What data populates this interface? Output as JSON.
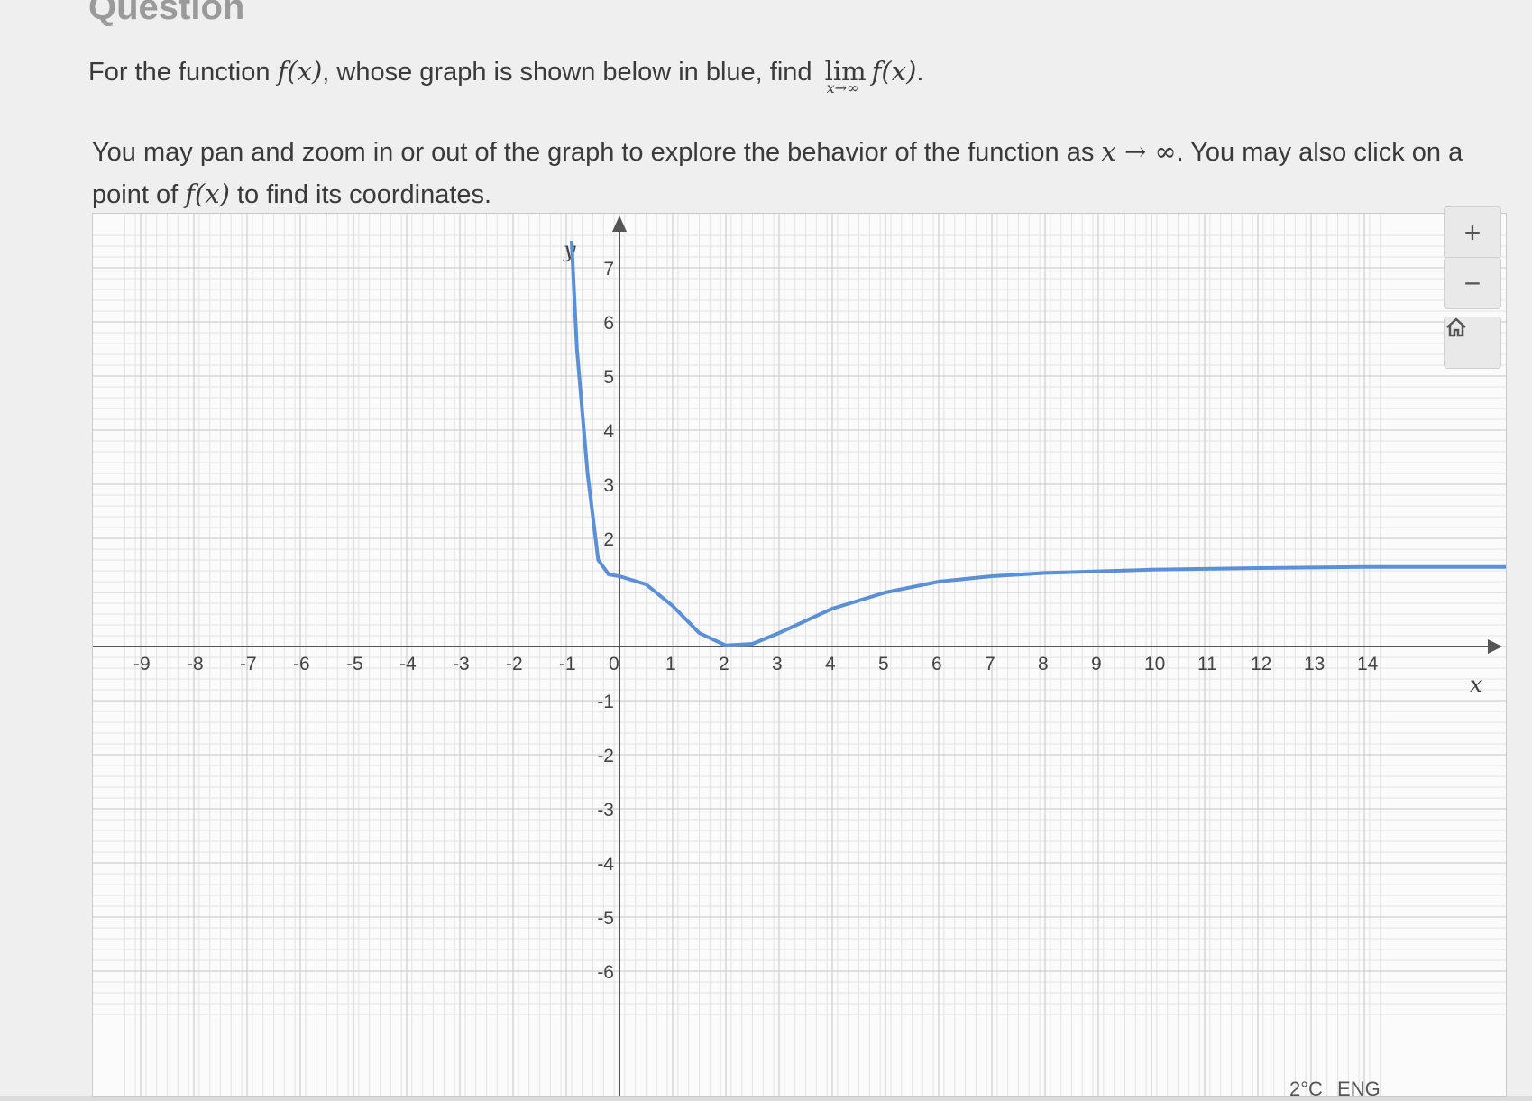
{
  "question": {
    "title": "Question",
    "line1_pre": "For the function ",
    "fx": "f(x)",
    "line1_mid": ", whose graph is shown below in blue, find ",
    "lim_word": "lim",
    "lim_sub": "x→∞",
    "line1_post": ".",
    "line2_a": "You may pan and zoom in or out of the graph to explore the behavior of the function as ",
    "x_to_inf": "x → ∞",
    "line2_b": ". You may also click on a point of ",
    "line2_c": " to find its coordinates."
  },
  "graph_controls": {
    "zoom_in": "+",
    "zoom_out": "−",
    "home_icon": "home-icon"
  },
  "axes": {
    "x_label": "x",
    "y_label": "y",
    "x_ticks": [
      "-9",
      "-8",
      "-7",
      "-6",
      "-5",
      "-4",
      "-3",
      "-2",
      "-1",
      "0",
      "1",
      "2",
      "3",
      "4",
      "5",
      "6",
      "7",
      "8",
      "9",
      "10",
      "11",
      "12",
      "13",
      "14"
    ],
    "y_ticks": [
      "7",
      "6",
      "5",
      "4",
      "3",
      "2",
      "-1",
      "-2",
      "-3",
      "-4",
      "-5",
      "-6"
    ]
  },
  "chart_data": {
    "type": "line",
    "series": [
      {
        "x": [
          -0.9,
          -0.8,
          -0.6,
          -0.4,
          -0.2,
          0,
          0.5,
          1,
          1.5,
          2,
          2.5,
          3,
          4,
          5,
          6,
          7,
          8,
          10,
          12,
          14
        ],
        "y": [
          7.5,
          5.5,
          3.2,
          1.6,
          1.33,
          1.3,
          1.15,
          0.75,
          0.25,
          0.02,
          0.05,
          0.25,
          0.7,
          1.0,
          1.2,
          1.3,
          1.36,
          1.42,
          1.45,
          1.47
        ],
        "color": "#5b8fd6"
      }
    ],
    "xlim": [
      -9.3,
      14.4
    ],
    "ylim": [
      -6.8,
      7.7
    ],
    "grid": true,
    "xlabel": "x",
    "ylabel": "y"
  },
  "taskbar": {
    "temp": "2°C",
    "lang": "ENG"
  }
}
